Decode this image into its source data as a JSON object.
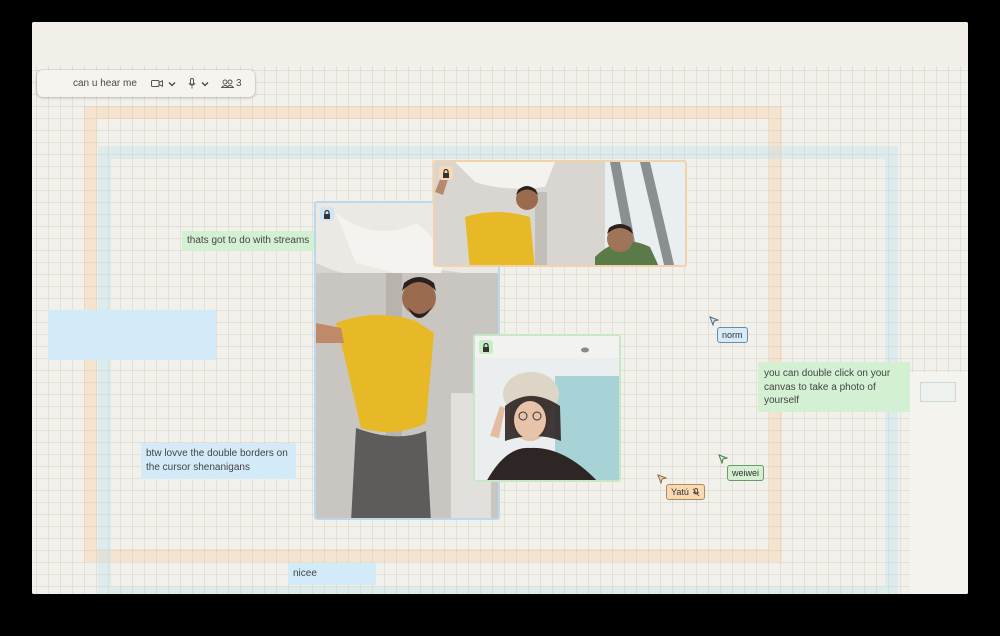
{
  "toolbar": {
    "room_name": "can u hear me",
    "participant_count": "3",
    "icons": [
      "menu-icon",
      "camera-icon",
      "chevron-down-icon",
      "microphone-icon",
      "people-icon"
    ]
  },
  "notes": {
    "streams": "thats got to do with streams",
    "borders": "btw lovve the double borders on the cursor shenanigans",
    "double_click": "you can double click on your canvas to take a photo of yourself",
    "nicee": "nicee",
    "blank": ""
  },
  "cursors": [
    {
      "name": "norm",
      "color": "#d6ebf7"
    },
    {
      "name": "weiwei",
      "color": "#d5efd3"
    },
    {
      "name": "Yatú",
      "color": "#f8d9b3"
    }
  ],
  "colors": {
    "note_green": "#d3f0d3",
    "note_blue": "#d3eaf8",
    "frame_orange": "#f5c896",
    "frame_blue": "#bee1f0"
  }
}
